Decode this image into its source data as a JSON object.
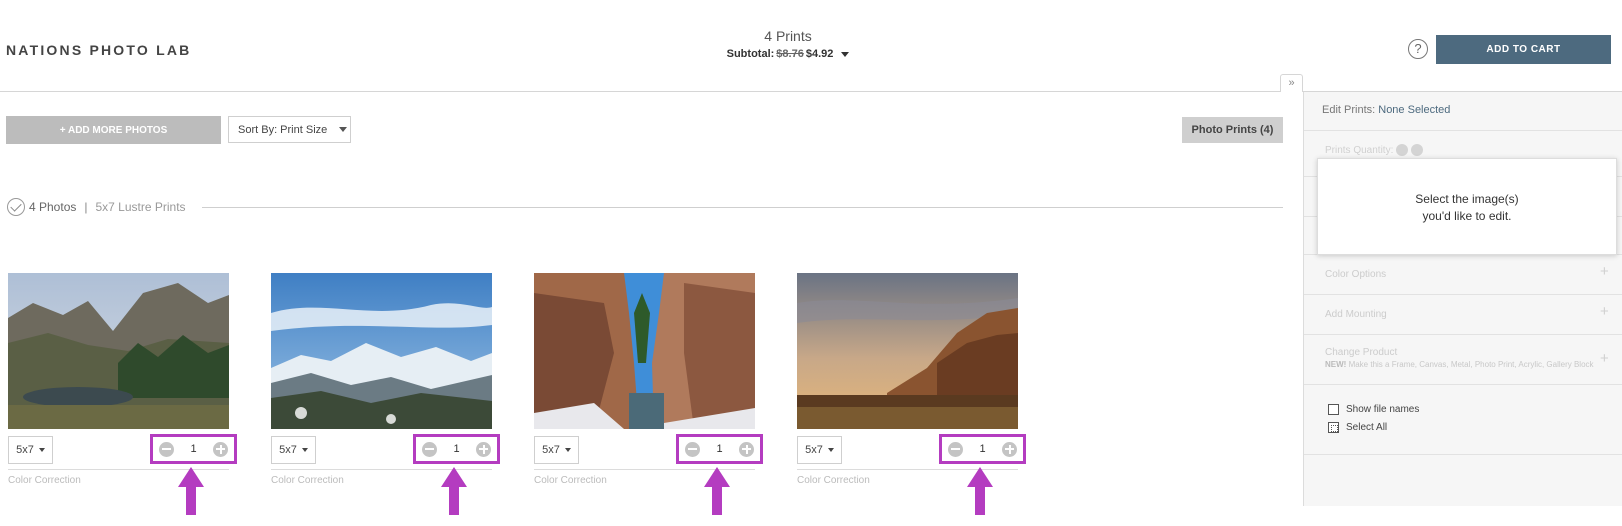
{
  "header": {
    "logo": "NATIONS PHOTO LAB",
    "prints_title": "4 Prints",
    "subtotal_label": "Subtotal:",
    "subtotal_old": "$8.76",
    "subtotal_new": "$4.92",
    "help_symbol": "?",
    "add_to_cart": "ADD TO CART",
    "accent_color": "#4d6a7f"
  },
  "toolbar": {
    "add_more": "+ ADD MORE PHOTOS",
    "sort_by": "Sort By: Print Size",
    "photo_prints": "Photo Prints (4)"
  },
  "section": {
    "count": "4 Photos",
    "separator": "|",
    "product": "5x7 Lustre Prints"
  },
  "cards": [
    {
      "size": "5x7",
      "qty": "1",
      "color_correction": "Color Correction",
      "image": "mountain-lake"
    },
    {
      "size": "5x7",
      "qty": "1",
      "color_correction": "Color Correction",
      "image": "snowy-mountains"
    },
    {
      "size": "5x7",
      "qty": "1",
      "color_correction": "Color Correction",
      "image": "canyon-rocks"
    },
    {
      "size": "5x7",
      "qty": "1",
      "color_correction": "Color Correction",
      "image": "sunset-cliff"
    }
  ],
  "highlight_color": "#b43cc0",
  "panel": {
    "collapse_symbol": "»",
    "edit_label": "Edit Prints:",
    "edit_value": "None Selected",
    "prints_quantity": "Prints Quantity:",
    "tooltip_line1": "Select the image(s)",
    "tooltip_line2": "you'd like to edit.",
    "color_options": "Color Options",
    "add_mounting": "Add Mounting",
    "change_product": "Change Product",
    "change_product_new": "NEW!",
    "change_product_note": "Make this a Frame, Canvas, Metal, Photo Print, Acrylic, Gallery Block",
    "plus_symbol": "+",
    "show_file_names": "Show file names",
    "select_all": "Select All"
  }
}
